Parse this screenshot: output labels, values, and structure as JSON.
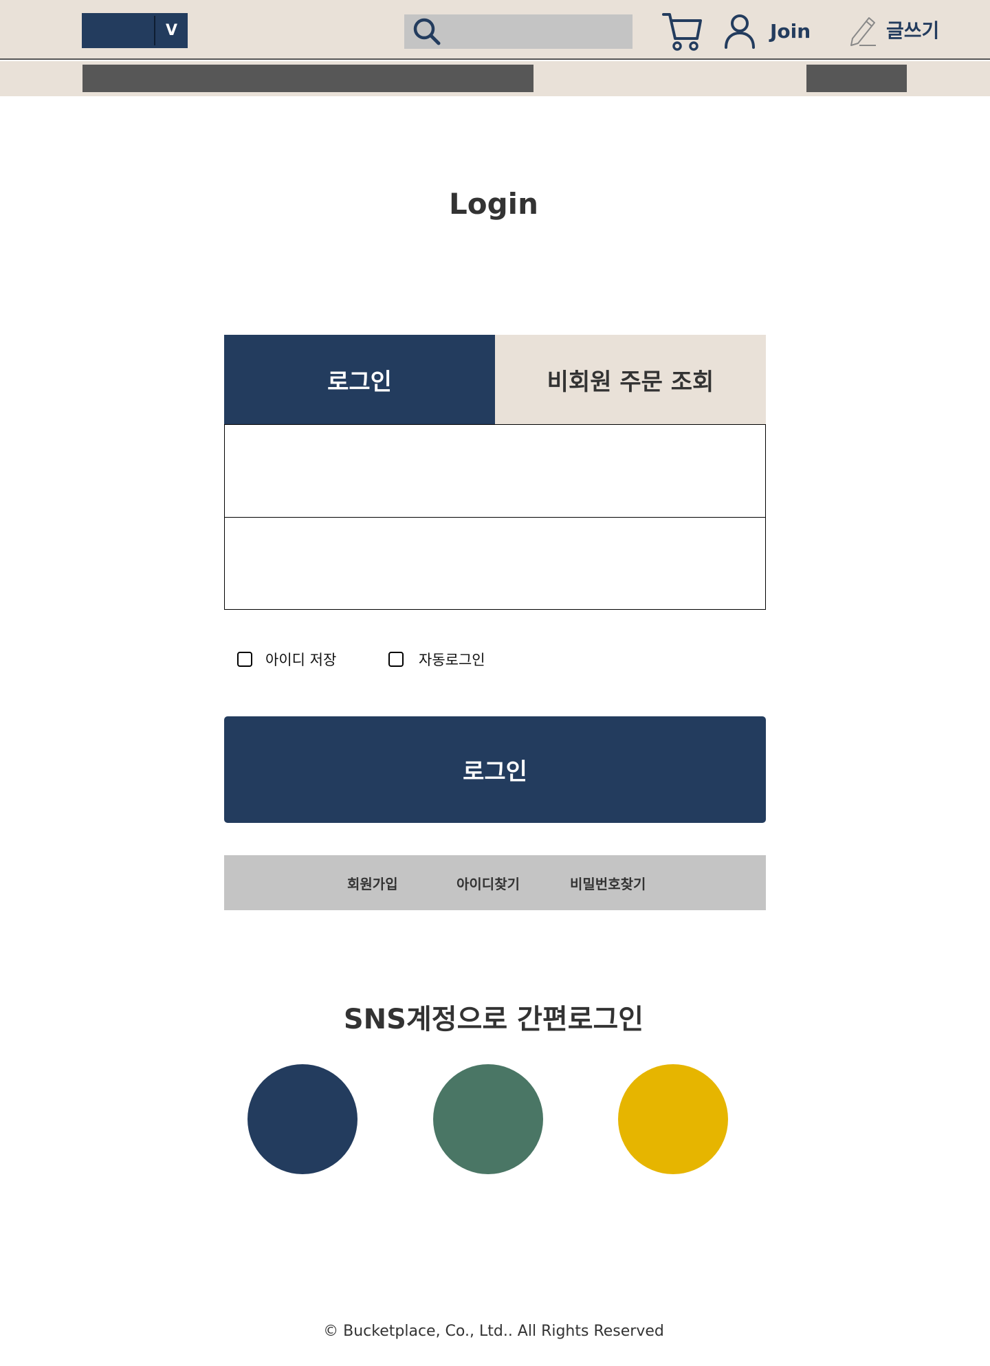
{
  "header": {
    "logo_toggle": "V",
    "search_placeholder": "",
    "join_label": "Join",
    "write_label": "글쓰기"
  },
  "main": {
    "title": "Login",
    "tabs": [
      {
        "label": "로그인",
        "active": true
      },
      {
        "label": "비회원 주문 조회",
        "active": false
      }
    ],
    "fields": {
      "id_value": "",
      "password_value": ""
    },
    "options": {
      "save_id_label": "아이디 저장",
      "auto_login_label": "자동로그인"
    },
    "login_button_label": "로그인",
    "links": {
      "join": "회원가입",
      "find_id": "아이디찾기",
      "find_password": "비밀번호찾기"
    },
    "sns": {
      "title": "SNS계정으로 간편로그인",
      "buttons": [
        {
          "color": "#233c5e"
        },
        {
          "color": "#4a7665"
        },
        {
          "color": "#e6b500"
        }
      ]
    }
  },
  "footer": {
    "copyright": "© Bucketplace, Co., Ltd.. All Rights Reserved"
  },
  "colors": {
    "brand_navy": "#233c5e",
    "header_beige": "#e9e1d8",
    "gray_block": "#c4c4c4",
    "dark_gray_block": "#575757"
  }
}
